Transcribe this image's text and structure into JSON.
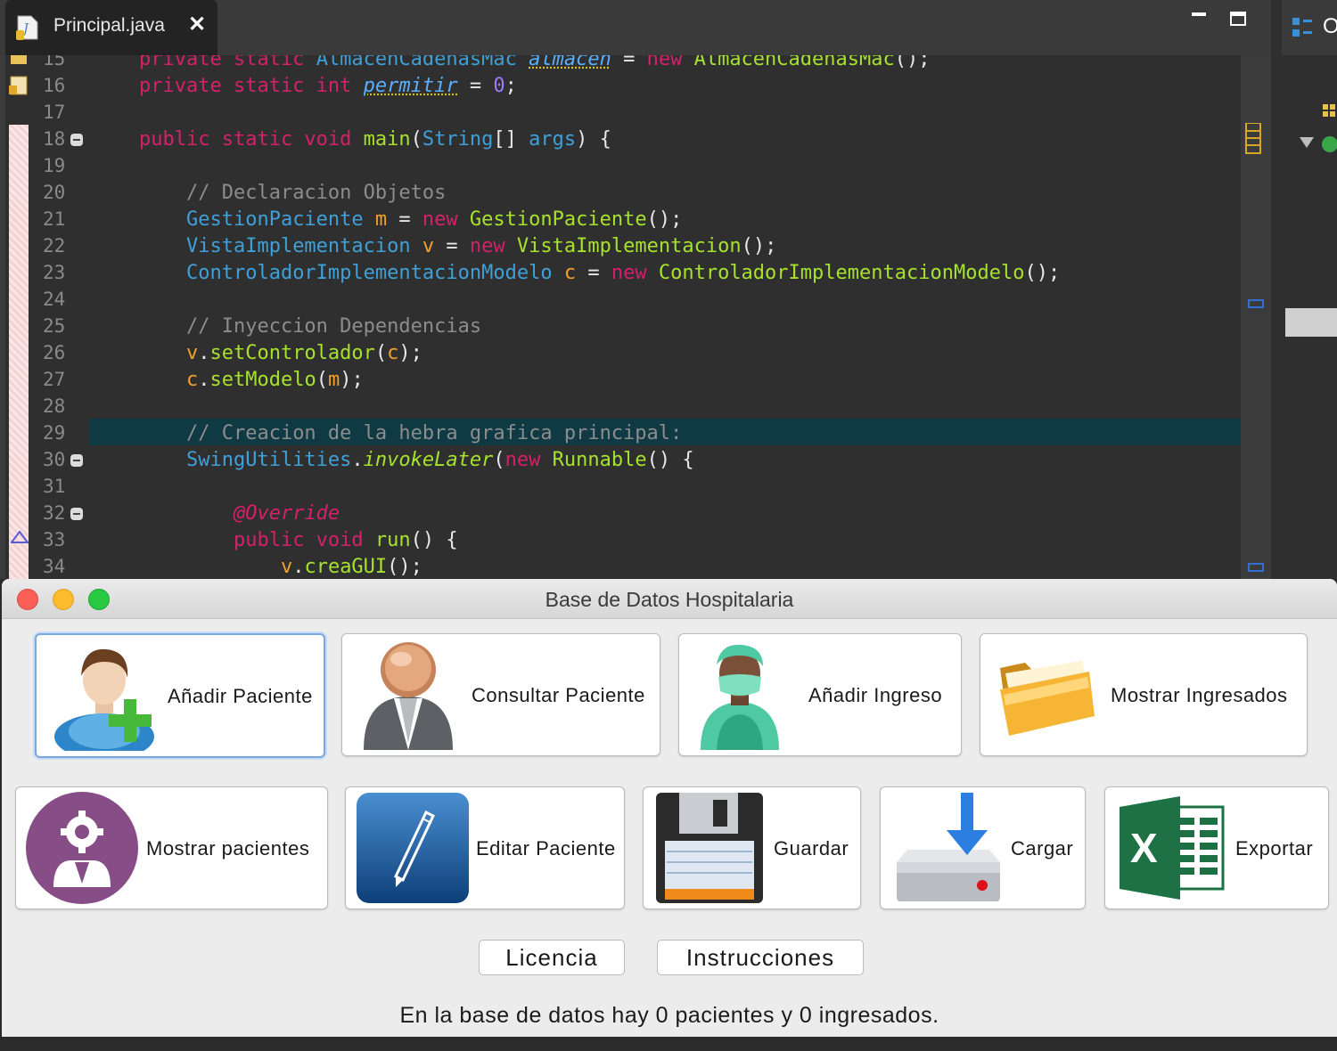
{
  "editor": {
    "tab_title": "Principal.java",
    "tab_close": "✕",
    "lines": [
      {
        "num": "15",
        "html": "<span class=\"kw\">private static</span> <span class=\"ty\">AlmacenCadenasMac</span> <span class=\"fi\">almacen</span> = <span class=\"kw\">new</span> <span class=\"mt\">AlmacenCadenasMac</span>();"
      },
      {
        "num": "16",
        "html": "<span class=\"kw\">private static int</span> <span class=\"fi\">permitir</span> = <span class=\"nm\">0</span>;"
      },
      {
        "num": "17",
        "html": ""
      },
      {
        "num": "18",
        "html": "<span class=\"kw\">public static void</span> <span class=\"mt\">main</span>(<span class=\"ty\">String</span>[] <span class=\"ty\">args</span>) {",
        "fold": true
      },
      {
        "num": "19",
        "html": ""
      },
      {
        "num": "20",
        "html": "    <span class=\"cm\">// Declaracion Objetos</span>"
      },
      {
        "num": "21",
        "html": "    <span class=\"ty\">GestionPaciente</span> <span class=\"vr\">m</span> = <span class=\"kw\">new</span> <span class=\"mt\">GestionPaciente</span>();"
      },
      {
        "num": "22",
        "html": "    <span class=\"ty\">VistaImplementacion</span> <span class=\"vr\">v</span> = <span class=\"kw\">new</span> <span class=\"mt\">VistaImplementacion</span>();"
      },
      {
        "num": "23",
        "html": "    <span class=\"ty\">ControladorImplementacionModelo</span> <span class=\"vr\">c</span> = <span class=\"kw\">new</span> <span class=\"mt\">ControladorImplementacionModelo</span>();"
      },
      {
        "num": "24",
        "html": ""
      },
      {
        "num": "25",
        "html": "    <span class=\"cm\">// Inyeccion Dependencias</span>"
      },
      {
        "num": "26",
        "html": "    <span class=\"vr\">v</span>.<span class=\"mt\">setControlador</span>(<span class=\"vr\">c</span>);"
      },
      {
        "num": "27",
        "html": "    <span class=\"vr\">c</span>.<span class=\"mt\">setModelo</span>(<span class=\"vr\">m</span>);"
      },
      {
        "num": "28",
        "html": ""
      },
      {
        "num": "29",
        "html": "    <span class=\"cm\">// Creacion de la hebra grafica principal:</span>"
      },
      {
        "num": "30",
        "html": "    <span class=\"ty\">SwingUtilities</span>.<span class=\"it\">invokeLater</span>(<span class=\"kw\">new</span> <span class=\"mt\">Runnable</span>() {",
        "fold": true
      },
      {
        "num": "31",
        "html": ""
      },
      {
        "num": "32",
        "html": "        <span class=\"an\">@Override</span>",
        "fold": true
      },
      {
        "num": "33",
        "html": "        <span class=\"kw\">public void</span> <span class=\"mt\">run</span>() {"
      },
      {
        "num": "34",
        "html": "            <span class=\"vr\">v</span>.<span class=\"mt\">creaGUI</span>();"
      }
    ]
  },
  "right_panel": {
    "tab_text": "O"
  },
  "dialog": {
    "title": "Base de Datos Hospitalaria",
    "buttons": {
      "anadir_paciente": "Añadir Paciente",
      "consultar_paciente": "Consultar Paciente",
      "anadir_ingreso": "Añadir Ingreso",
      "mostrar_ingresados": "Mostrar Ingresados",
      "mostrar_pacientes": "Mostrar pacientes",
      "editar_paciente": "Editar Paciente",
      "guardar": "Guardar",
      "cargar": "Cargar",
      "exportar": "Exportar",
      "licencia": "Licencia",
      "instrucciones": "Instrucciones"
    },
    "status": "En la base de datos hay 0 pacientes y 0 ingresados."
  },
  "colors": {
    "editor_bg": "#2f2f2f",
    "keyword": "#d3216a",
    "type": "#3fa0d8",
    "method": "#a6e22e",
    "comment": "#8c8c8c",
    "highlight_line": "#0f3a44",
    "focus_ring": "#7aa7e0"
  }
}
